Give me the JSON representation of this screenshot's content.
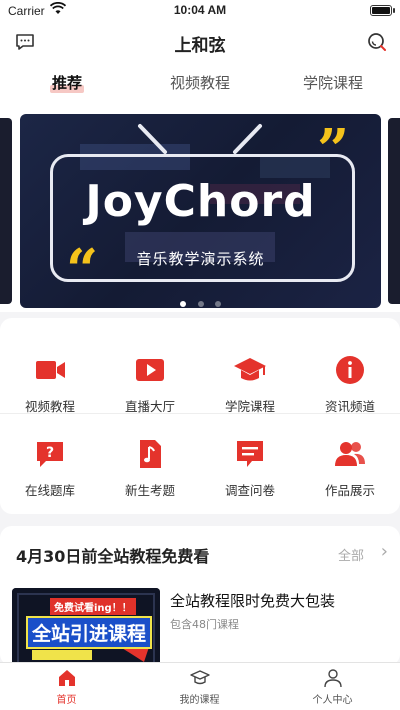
{
  "status_bar": {
    "carrier": "Carrier",
    "time": "10:04 AM"
  },
  "nav": {
    "title": "上和弦",
    "left_icon": "message-icon",
    "right_icon": "search-icon"
  },
  "tabs": [
    {
      "label": "推荐",
      "active": true
    },
    {
      "label": "视频教程",
      "active": false
    },
    {
      "label": "学院课程",
      "active": false
    }
  ],
  "banner": {
    "brand": "JoyChord",
    "subtitle": "音乐教学演示系统",
    "open_quote": "“",
    "close_quote": "”",
    "slide_count": 3,
    "active_slide": 1
  },
  "menu": [
    {
      "label": "视频教程",
      "icon": "video-camera-icon"
    },
    {
      "label": "直播大厅",
      "icon": "play-icon"
    },
    {
      "label": "学院课程",
      "icon": "graduation-cap-icon"
    },
    {
      "label": "资讯频道",
      "icon": "info-icon"
    },
    {
      "label": "在线题库",
      "icon": "question-icon"
    },
    {
      "label": "新生考题",
      "icon": "music-note-icon"
    },
    {
      "label": "调查问卷",
      "icon": "chat-form-icon"
    },
    {
      "label": "作品展示",
      "icon": "users-icon"
    }
  ],
  "free_section": {
    "heading": "4月30日前全站教程免费看",
    "more_label": "全部",
    "more_chevron": "›",
    "course": {
      "title": "全站教程限时免费大包装",
      "subtitle": "包含48门课程",
      "thumb_badge": "免费试看ing！！",
      "thumb_text": "全站引进课程"
    }
  },
  "tabbar": [
    {
      "label": "首页",
      "icon": "home-icon",
      "active": true
    },
    {
      "label": "我的课程",
      "icon": "graduation-cap-outline-icon",
      "active": false
    },
    {
      "label": "个人中心",
      "icon": "person-icon",
      "active": false
    }
  ],
  "colors": {
    "accent": "#e4332c",
    "banner_bg": "#1a2240",
    "quote": "#f4c21b"
  }
}
